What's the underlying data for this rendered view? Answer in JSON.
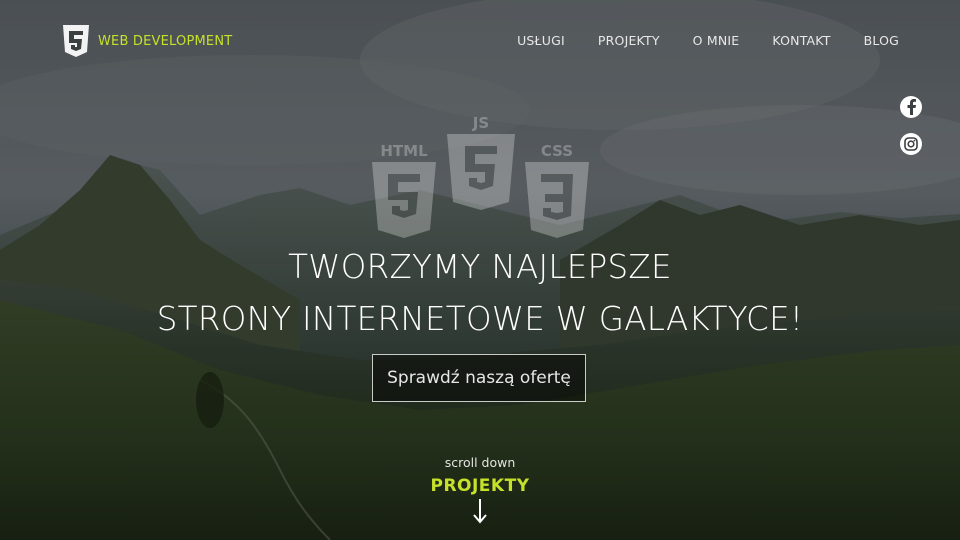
{
  "brand": {
    "name": "WEB DEVELOPMENT",
    "logo": "html5-like-shield-logo"
  },
  "nav": {
    "items": [
      "USŁUGI",
      "PROJEKTY",
      "O MNIE",
      "KONTAKT",
      "BLOG"
    ]
  },
  "social": {
    "facebook": "facebook-icon",
    "instagram": "instagram-icon"
  },
  "badges": {
    "html": "HTML",
    "js": "JS",
    "css": "CSS"
  },
  "hero": {
    "headline_line1": "TWORZYMY NAJLEPSZE",
    "headline_line2": "STRONY INTERNETOWE W GALAKTYCE!",
    "cta_label": "Sprawdź naszą ofertę"
  },
  "scroll": {
    "hint": "scroll down",
    "target": "PROJEKTY",
    "arrow_icon": "arrow-down-icon"
  },
  "colors": {
    "accent": "#c6e12a",
    "text": "#ffffff"
  }
}
